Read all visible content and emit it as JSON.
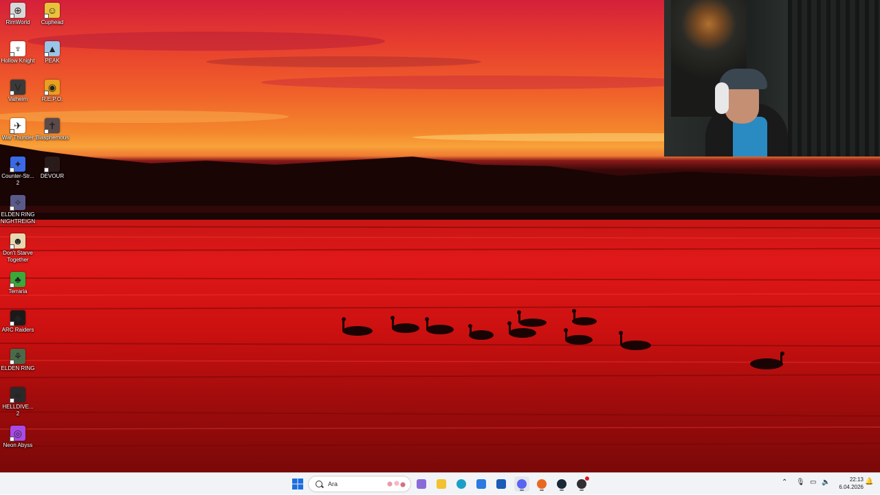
{
  "desktop": {
    "icons": [
      {
        "label": "RimWorld",
        "color": "#d8d8d8",
        "glyph": "⊕"
      },
      {
        "label": "Cuphead",
        "color": "#e8c23a",
        "glyph": "☺"
      },
      {
        "label": "Hollow Knight",
        "color": "#ffffff",
        "glyph": "♆"
      },
      {
        "label": "PEAK",
        "color": "#9ac4e8",
        "glyph": "▲"
      },
      {
        "label": "Valheim",
        "color": "#3a3a3a",
        "glyph": "V"
      },
      {
        "label": "R.E.P.O.",
        "color": "#e8a020",
        "glyph": "◉"
      },
      {
        "label": "War Thunder",
        "color": "#ffffff",
        "glyph": "✈"
      },
      {
        "label": "Blasphemous",
        "color": "#5a4a4a",
        "glyph": "✝"
      },
      {
        "label": "Counter-Str... 2",
        "color": "#3a6ae8",
        "glyph": "✦"
      },
      {
        "label": "DEVOUR",
        "color": "#2a1a1a",
        "glyph": "ϒ"
      },
      {
        "label": "ELDEN RING NIGHTREIGN",
        "color": "#5a5a8a",
        "glyph": "✧"
      },
      {
        "label": "Don't Starve Together",
        "color": "#e8d8b0",
        "glyph": "☻"
      },
      {
        "label": "Terraria",
        "color": "#3aa83a",
        "glyph": "♣"
      },
      {
        "label": "ARC Raiders",
        "color": "#1a1a1a",
        "glyph": "◆"
      },
      {
        "label": "ELDEN RING",
        "color": "#4a6a4a",
        "glyph": "⚘"
      },
      {
        "label": "HELLDIVE... 2",
        "color": "#2a2a2a",
        "glyph": "☠"
      },
      {
        "label": "Neon Abyss",
        "color": "#a84ae8",
        "glyph": "◎"
      }
    ]
  },
  "taskbar": {
    "search_placeholder": "Ara",
    "apps": [
      {
        "name": "start",
        "color": "#1a6ee0"
      },
      {
        "name": "widgets",
        "color": "#8a6ad8"
      },
      {
        "name": "file-explorer",
        "color": "#f2c230"
      },
      {
        "name": "edge",
        "color": "#1aa0c8"
      },
      {
        "name": "store",
        "color": "#2a7ae0"
      },
      {
        "name": "outlook",
        "color": "#1a5ab8"
      },
      {
        "name": "discord",
        "color": "#5865f2"
      },
      {
        "name": "firefox",
        "color": "#e86a20"
      },
      {
        "name": "steam",
        "color": "#1b2838"
      },
      {
        "name": "obs",
        "color": "#302e31"
      }
    ],
    "clock": {
      "time": "22:13",
      "date": "6.04.2026"
    }
  }
}
